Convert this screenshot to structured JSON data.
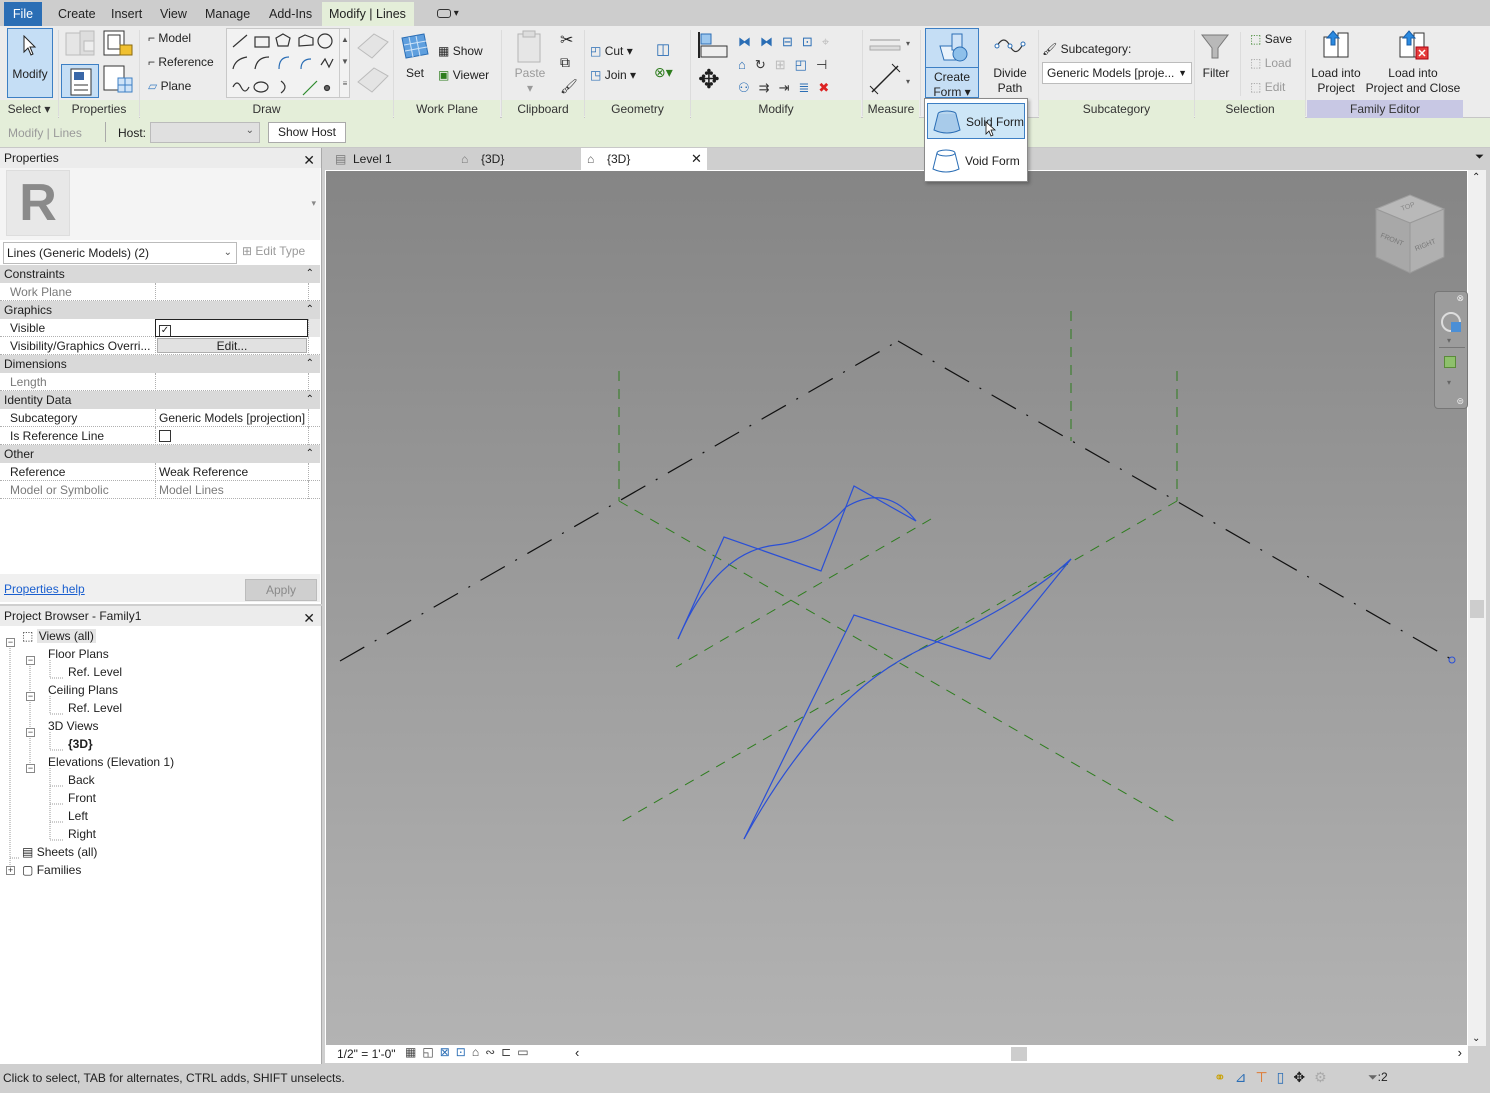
{
  "menubar": {
    "tabs": [
      "File",
      "Create",
      "Insert",
      "View",
      "Manage",
      "Add-Ins",
      "Modify | Lines"
    ],
    "active_tab": "Modify | Lines"
  },
  "ribbon": {
    "select": {
      "modify_label": "Modify",
      "panel_label": "Select"
    },
    "properties": {
      "panel_label": "Properties"
    },
    "draw": {
      "model": "Model",
      "reference": "Reference",
      "plane": "Plane",
      "panel_label": "Draw"
    },
    "work_plane": {
      "set": "Set",
      "show": "Show",
      "viewer": "Viewer",
      "panel_label": "Work Plane"
    },
    "clipboard": {
      "paste": "Paste",
      "panel_label": "Clipboard"
    },
    "geometry": {
      "cut": "Cut",
      "join": "Join",
      "panel_label": "Geometry"
    },
    "modify": {
      "panel_label": "Modify"
    },
    "measure": {
      "panel_label": "Measure"
    },
    "form": {
      "create_form_line1": "Create",
      "create_form_line2": "Form",
      "divide_path_line1": "Divide",
      "divide_path_line2": "Path"
    },
    "subcategory": {
      "label": "Subcategory:",
      "value": "Generic Models [proje...",
      "panel_label": "Subcategory"
    },
    "selection": {
      "filter": "Filter",
      "save": "Save",
      "load": "Load",
      "edit": "Edit",
      "panel_label": "Selection"
    },
    "family_editor": {
      "load_into_project_1": "Load into",
      "load_into_project_2": "Project",
      "load_close_1": "Load into",
      "load_close_2": "Project and Close",
      "panel_label": "Family Editor"
    }
  },
  "create_form_menu": {
    "items": [
      {
        "label": "Solid Form",
        "highlighted": true
      },
      {
        "label": "Void Form",
        "highlighted": false
      }
    ]
  },
  "options_bar": {
    "context": "Modify | Lines",
    "host_label": "Host:",
    "host_value": "",
    "show_host": "Show Host"
  },
  "properties": {
    "title": "Properties",
    "type_selector": "Lines (Generic Models) (2)",
    "edit_type": "Edit Type",
    "groups": [
      {
        "name": "Constraints",
        "rows": [
          {
            "key": "Work Plane",
            "value": "",
            "disabled": true
          }
        ]
      },
      {
        "name": "Graphics",
        "rows": [
          {
            "key": "Visible",
            "value": "checked",
            "type": "checkbox"
          },
          {
            "key": "Visibility/Graphics Overri...",
            "value": "Edit...",
            "type": "button"
          }
        ]
      },
      {
        "name": "Dimensions",
        "rows": [
          {
            "key": "Length",
            "value": "",
            "disabled": true
          }
        ]
      },
      {
        "name": "Identity Data",
        "rows": [
          {
            "key": "Subcategory",
            "value": "Generic Models [projection]"
          },
          {
            "key": "Is Reference Line",
            "value": "unchecked",
            "type": "checkbox"
          }
        ]
      },
      {
        "name": "Other",
        "rows": [
          {
            "key": "Reference",
            "value": "Weak Reference"
          },
          {
            "key": "Model or Symbolic",
            "value": "Model Lines",
            "disabled": true
          }
        ]
      }
    ],
    "help_link": "Properties help",
    "apply": "Apply"
  },
  "project_browser": {
    "title": "Project Browser - Family1",
    "tree": {
      "views_all": "Views (all)",
      "floor_plans": "Floor Plans",
      "floor_ref_level": "Ref. Level",
      "ceiling_plans": "Ceiling Plans",
      "ceiling_ref_level": "Ref. Level",
      "views_3d": "3D Views",
      "view_3d_item": "{3D}",
      "elevations": "Elevations (Elevation 1)",
      "back": "Back",
      "front": "Front",
      "left": "Left",
      "right": "Right",
      "sheets": "Sheets (all)",
      "families": "Families"
    }
  },
  "view_tabs": [
    {
      "label": "Level 1",
      "active": false
    },
    {
      "label": "{3D}",
      "active": false
    },
    {
      "label": "{3D}",
      "active": true
    }
  ],
  "viewcube": {
    "top": "TOP",
    "front": "FRONT",
    "right": "RIGHT"
  },
  "view_control_bar": {
    "scale": "1/2\" = 1'-0\""
  },
  "status_bar": {
    "message": "Click to select, TAB for alternates, CTRL adds, SHIFT unselects.",
    "filter_count": ":2"
  },
  "colors": {
    "file_tab": "#2b6eb5",
    "context_tab": "#e4eed9",
    "family_editor_panel": "#c8c8e4",
    "model_line": "#2a4fd6",
    "ref_plane": "#2e7d1e",
    "level_line": "#111111",
    "highlight": "#cde6f7"
  }
}
